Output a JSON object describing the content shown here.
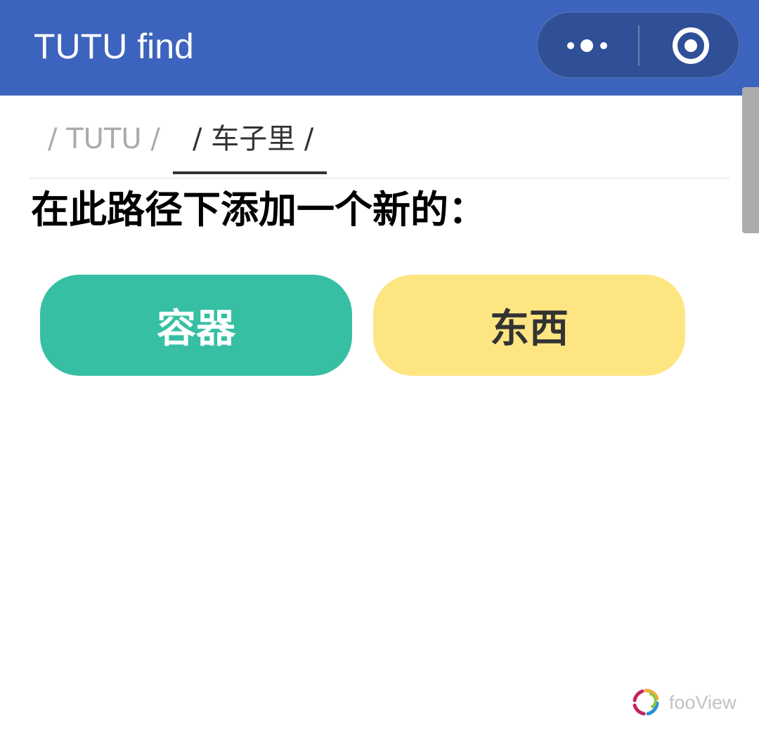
{
  "header": {
    "title": "TUTU find",
    "background_color": "#3c63bd",
    "more_icon": "more-dots-icon",
    "close_icon": "target-circle-icon"
  },
  "breadcrumb": {
    "items": [
      {
        "label": "/ TUTU /",
        "active": false
      },
      {
        "label": "/ 车子里 /",
        "active": true
      }
    ]
  },
  "main": {
    "heading": "在此路径下添加一个新的："
  },
  "actions": {
    "container_label": "容器",
    "container_color": "#36bfa3",
    "thing_label": "东西",
    "thing_color": "#fde682"
  },
  "watermark": {
    "text": "fooView",
    "icon": "fooview-logo-icon"
  }
}
